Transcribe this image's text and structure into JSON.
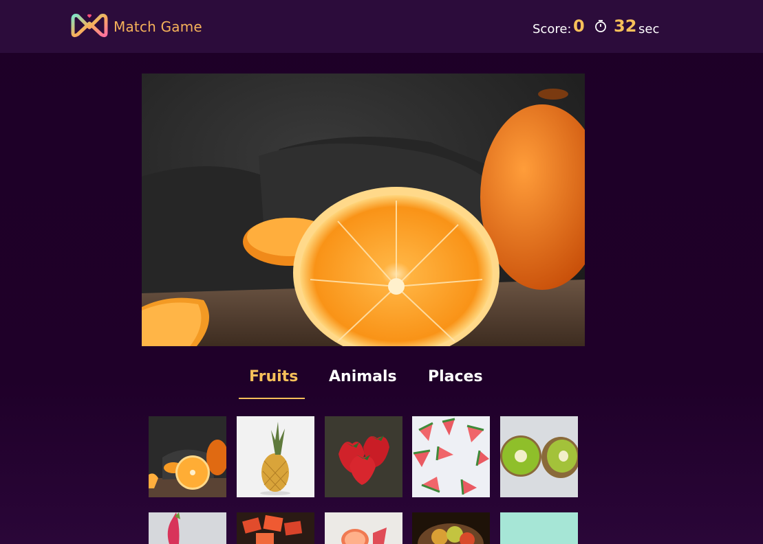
{
  "header": {
    "logo_text": "Match Game",
    "score_label": "Score:",
    "score_value": "0",
    "timer_value": "32",
    "timer_unit": "sec"
  },
  "hero": {
    "subject": "halved-orange-photo"
  },
  "tabs": [
    {
      "label": "Fruits",
      "active": true
    },
    {
      "label": "Animals",
      "active": false
    },
    {
      "label": "Places",
      "active": false
    }
  ],
  "tiles_row1": [
    "oranges",
    "pineapple",
    "strawberries",
    "watermelon-slices",
    "kiwi"
  ],
  "tiles_row2": [
    "dragon-fruit",
    "papaya",
    "grapefruit-platter",
    "apple-bowl",
    "mint-background"
  ],
  "colors": {
    "accent": "#f7c05a",
    "header_bg": "#2c0c3b",
    "page_bg": "#1f0029"
  }
}
